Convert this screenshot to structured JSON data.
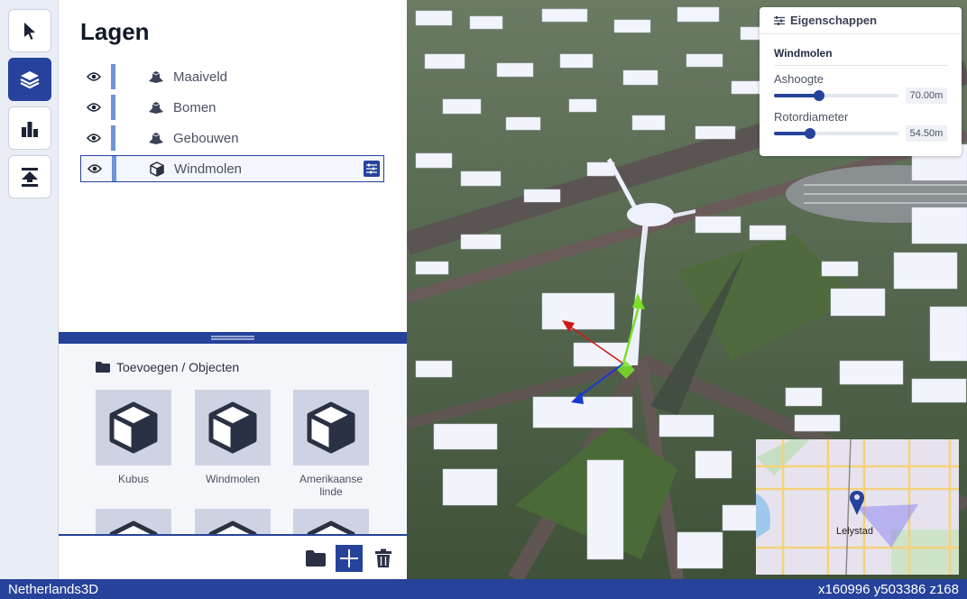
{
  "toolbar": {
    "tools": [
      {
        "name": "select-tool",
        "icon": "cursor-icon",
        "active": false
      },
      {
        "name": "layers-tool",
        "icon": "layers-icon",
        "active": true
      },
      {
        "name": "statistics-tool",
        "icon": "bar-chart-icon",
        "active": false
      },
      {
        "name": "import-tool",
        "icon": "download-icon",
        "active": false
      }
    ]
  },
  "layers_panel": {
    "title": "Lagen",
    "layers": [
      {
        "name": "Maaiveld",
        "icon": "terrain-layer-icon",
        "selected": false
      },
      {
        "name": "Bomen",
        "icon": "terrain-layer-icon",
        "selected": false
      },
      {
        "name": "Gebouwen",
        "icon": "terrain-layer-icon",
        "selected": false
      },
      {
        "name": "Windmolen",
        "icon": "cube-icon",
        "selected": true
      }
    ]
  },
  "objects_panel": {
    "header": "Toevoegen / Objecten",
    "objects": [
      {
        "label": "Kubus"
      },
      {
        "label": "Windmolen"
      },
      {
        "label": "Amerikaanse linde"
      }
    ]
  },
  "properties_panel": {
    "title": "Eigenschappen",
    "section": "Windmolen",
    "sliders": [
      {
        "label": "Ashoogte",
        "value": "70.00m",
        "fraction": 0.36
      },
      {
        "label": "Rotordiameter",
        "value": "54.50m",
        "fraction": 0.29
      }
    ]
  },
  "minimap": {
    "city_label": "Lelystad"
  },
  "statusbar": {
    "app_name": "Netherlands3D",
    "coordinates": "x160996 y503386 z168"
  },
  "colors": {
    "accent": "#26429a",
    "layer_bar": "#6e93d9"
  }
}
